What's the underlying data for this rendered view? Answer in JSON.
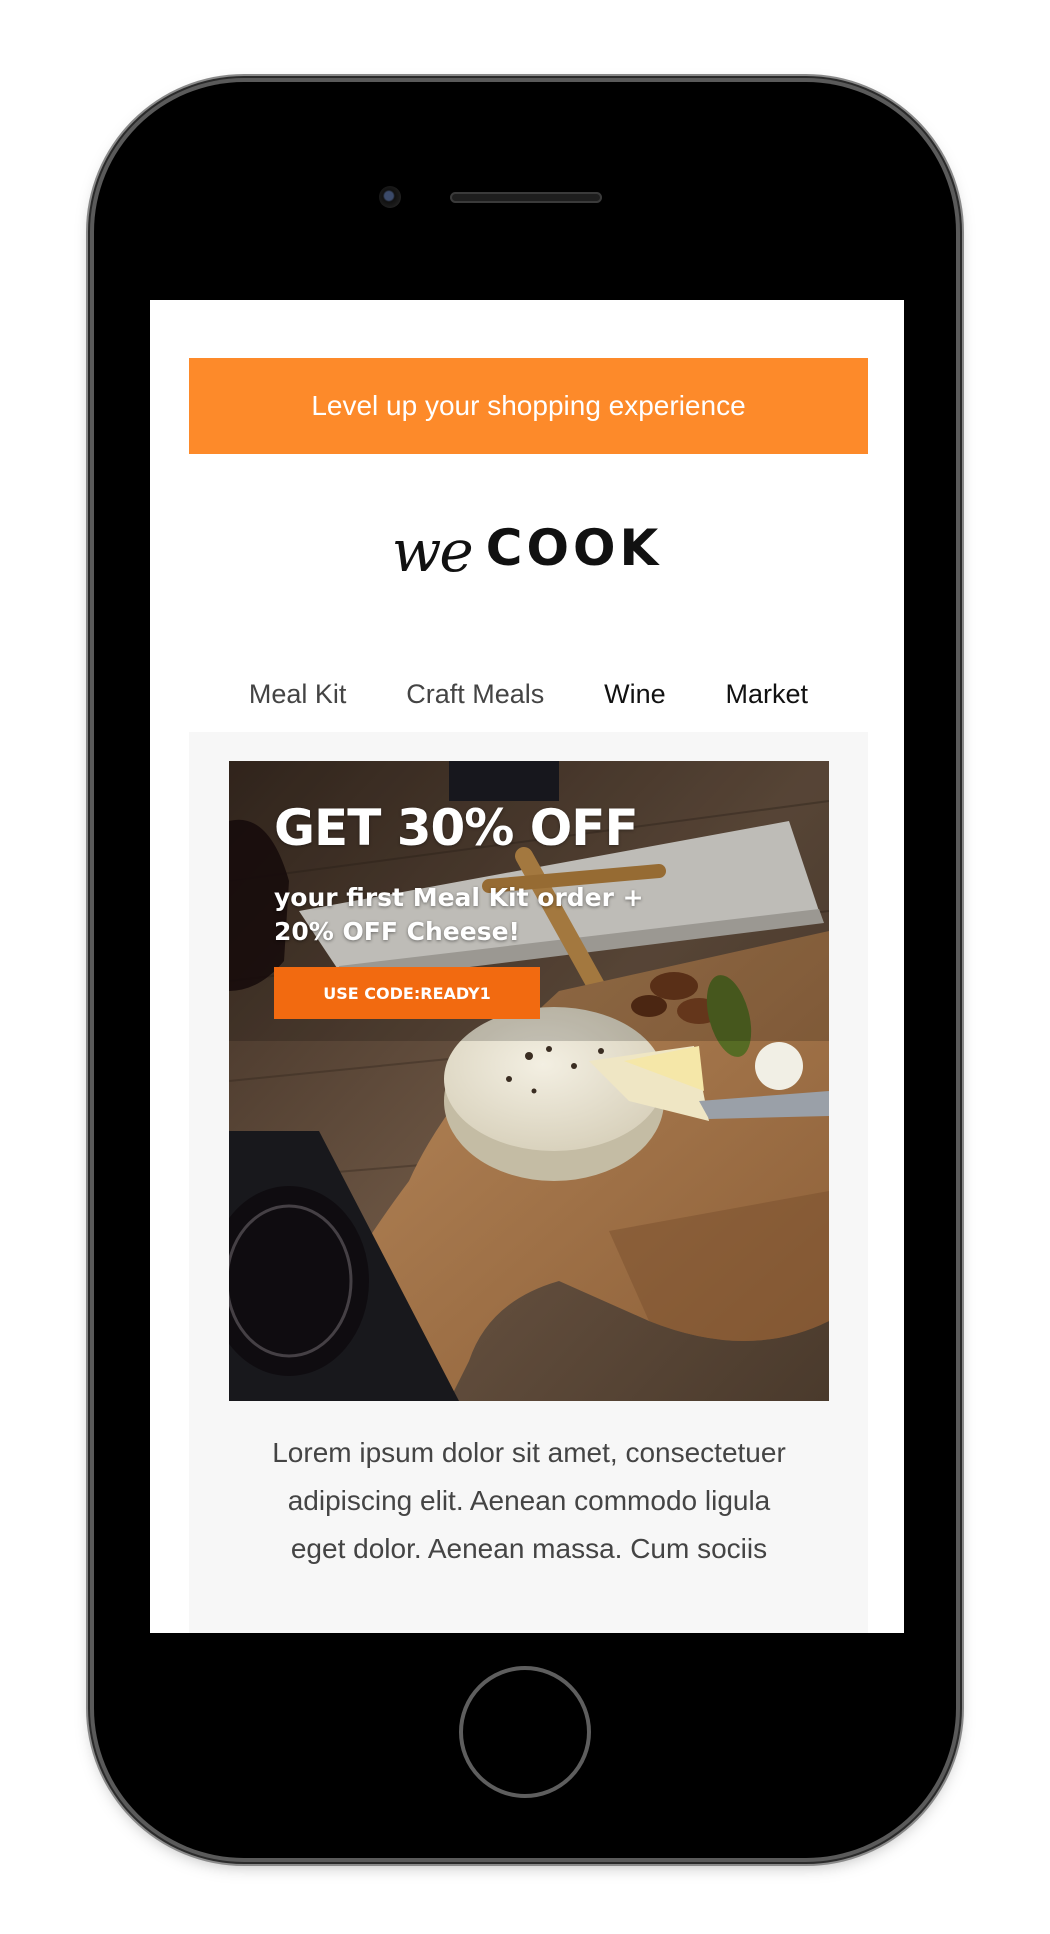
{
  "promo_bar": {
    "text": "Level up your shopping experience",
    "color": "#fd8a2a"
  },
  "logo": {
    "script": "we",
    "word": "COOK"
  },
  "nav": {
    "items": [
      {
        "label": "Meal Kit"
      },
      {
        "label": "Craft Meals"
      },
      {
        "label": "Wine"
      },
      {
        "label": "Market"
      }
    ]
  },
  "hero": {
    "headline": "GET 30% OFF",
    "subtext": "your first Meal Kit order + 20% OFF  Cheese!",
    "cta_label": "USE CODE:READY1",
    "cta_color": "#f26a10"
  },
  "body": {
    "text": "Lorem ipsum dolor sit amet, consectetuer adipiscing elit. Aenean commodo ligula eget dolor. Aenean massa. Cum sociis"
  },
  "icons": [
    "front-camera-icon",
    "speaker-grille-icon",
    "home-button-icon"
  ]
}
